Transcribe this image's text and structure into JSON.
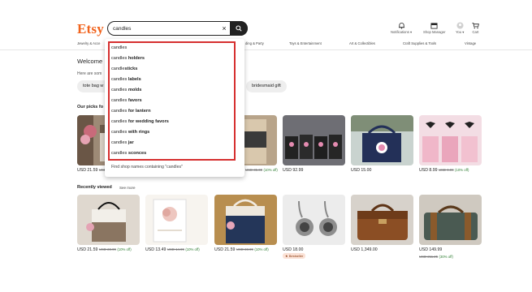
{
  "header": {
    "logo": "Etsy",
    "search_value": "candles",
    "clear_icon": "×",
    "notifications_label": "Notifications ▾",
    "shop_manager_label": "Shop Manager",
    "you_label": "You ▾",
    "cart_label": "Cart"
  },
  "categories": [
    "Jewelry & Acce",
    "ding & Party",
    "Toys & Entertainment",
    "Art & Collectibles",
    "Craft Supplies & Tools",
    "Vintage"
  ],
  "welcome": "Welcome",
  "here_are": "Here are som",
  "chips": [
    "tote bag w",
    "bridesmaid gift"
  ],
  "dropdown": {
    "suggestions": [
      {
        "base": "candles",
        "suffix": ""
      },
      {
        "base": "candles ",
        "suffix": "holders"
      },
      {
        "base": "candle",
        "suffix": "sticks"
      },
      {
        "base": "candles ",
        "suffix": "labels"
      },
      {
        "base": "candles ",
        "suffix": "molds"
      },
      {
        "base": "candles ",
        "suffix": "favors"
      },
      {
        "base": "candles ",
        "suffix": "for lantern"
      },
      {
        "base": "candles ",
        "suffix": "for wedding favors"
      },
      {
        "base": "candles ",
        "suffix": "with rings"
      },
      {
        "base": "candles ",
        "suffix": "jar"
      },
      {
        "base": "candles ",
        "suffix": "sconces"
      }
    ],
    "find_shops": "Find shop names containing \"candles\""
  },
  "picks": {
    "title": "Our picks fo",
    "items": [
      {
        "price": "USD 21.59",
        "old": "USD",
        "off": ""
      },
      {
        "price": "",
        "old": "USD 35.00",
        "off": "(10% off)"
      },
      {
        "price": "USD 92.99",
        "old": "",
        "off": ""
      },
      {
        "price": "USD 15.00",
        "old": "",
        "off": ""
      },
      {
        "price": "USD 8.99",
        "old": "USD 9.99",
        "off": "(10% off)"
      }
    ]
  },
  "recent": {
    "title": "Recently viewed",
    "see_more": "See more",
    "items": [
      {
        "price": "USD 21.59",
        "old": "USD 23.99",
        "off": "(10% off)"
      },
      {
        "price": "USD 13.49",
        "old": "USD 14.99",
        "off": "(10% off)"
      },
      {
        "price": "USD 21.59",
        "old": "USD 23.99",
        "off": "(10% off)"
      },
      {
        "price": "USD 18.00",
        "old": "",
        "off": ""
      },
      {
        "price": "USD 1,349.00",
        "old": "",
        "off": ""
      },
      {
        "price": "USD 149.99",
        "old": "",
        "off": ""
      }
    ],
    "last_old": "USD 211.25",
    "last_off": "(30% off)",
    "bestseller": "★ Bestseller"
  },
  "colors": {
    "brand": "#f1641e",
    "highlight_border": "#d62f2f",
    "discount": "#2e7d32"
  }
}
